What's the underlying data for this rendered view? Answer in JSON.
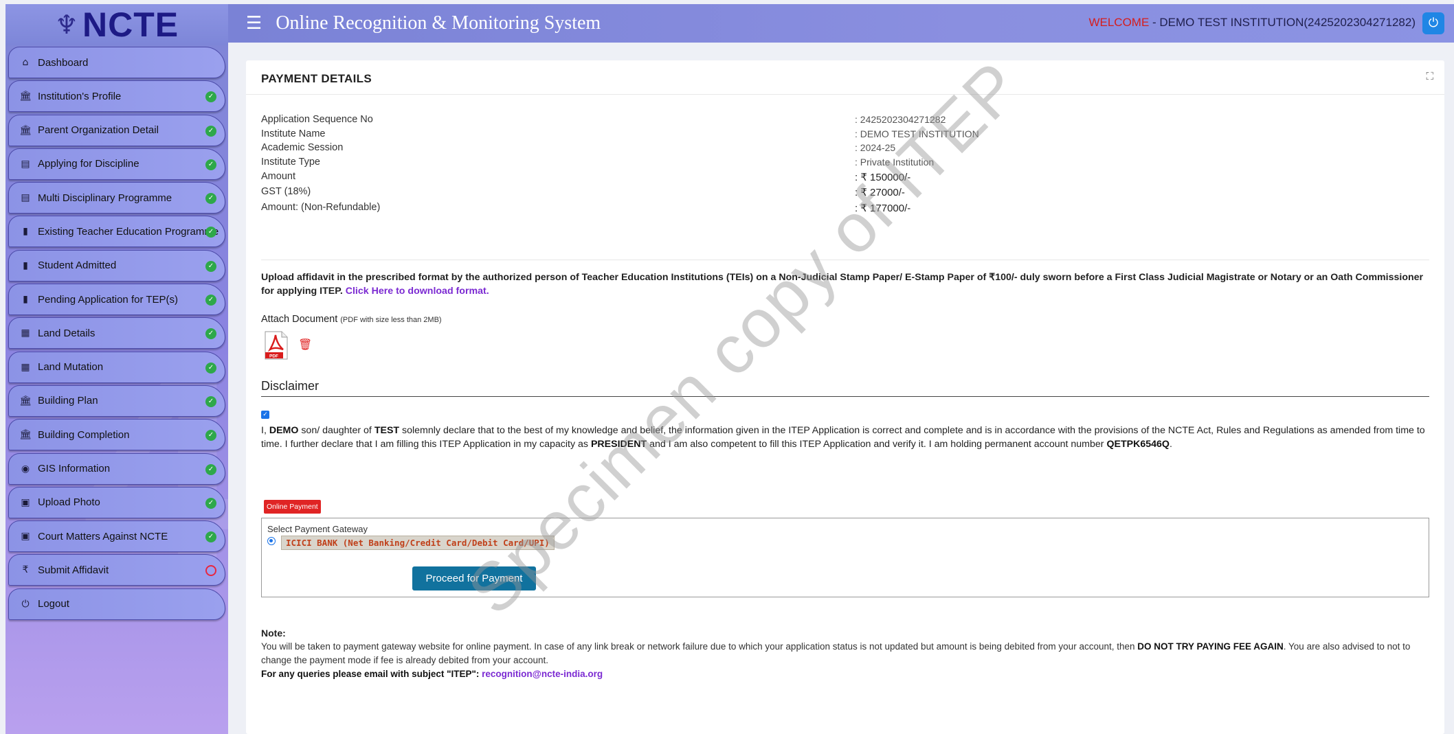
{
  "sidebar": {
    "logo_text": "NCTE",
    "items": [
      {
        "label": "Dashboard",
        "icon": "home-icon",
        "glyph": "⌂",
        "status": "none"
      },
      {
        "label": "Institution's Profile",
        "icon": "institution-icon",
        "glyph": "🏛",
        "status": "done"
      },
      {
        "label": "Parent Organization Detail",
        "icon": "institution-icon",
        "glyph": "🏛",
        "status": "done"
      },
      {
        "label": "Applying for Discipline",
        "icon": "list-icon",
        "glyph": "▤",
        "status": "done"
      },
      {
        "label": "Multi Disciplinary Programme",
        "icon": "list-icon",
        "glyph": "▤",
        "status": "done"
      },
      {
        "label": "Existing Teacher Education Programme",
        "icon": "book-icon",
        "glyph": "▮",
        "status": "done"
      },
      {
        "label": "Student Admitted",
        "icon": "book-icon",
        "glyph": "▮",
        "status": "done"
      },
      {
        "label": "Pending Application for TEP(s)",
        "icon": "book-icon",
        "glyph": "▮",
        "status": "done"
      },
      {
        "label": "Land Details",
        "icon": "grid-icon",
        "glyph": "▦",
        "status": "done"
      },
      {
        "label": "Land Mutation",
        "icon": "table-icon",
        "glyph": "▦",
        "status": "done"
      },
      {
        "label": "Building Plan",
        "icon": "institution-icon",
        "glyph": "🏛",
        "status": "done"
      },
      {
        "label": "Building Completion",
        "icon": "institution-icon",
        "glyph": "🏛",
        "status": "done"
      },
      {
        "label": "GIS Information",
        "icon": "globe-icon",
        "glyph": "◉",
        "status": "done"
      },
      {
        "label": "Upload Photo",
        "icon": "image-icon",
        "glyph": "▣",
        "status": "done"
      },
      {
        "label": "Court Matters Against NCTE",
        "icon": "image-icon",
        "glyph": "▣",
        "status": "done"
      },
      {
        "label": "Submit Affidavit",
        "icon": "rupee-icon",
        "glyph": "₹",
        "status": "pending"
      },
      {
        "label": "Logout",
        "icon": "power-icon",
        "glyph": "⏻",
        "status": "none"
      }
    ]
  },
  "header": {
    "title": "Online Recognition & Monitoring System",
    "welcome_word": "WELCOME",
    "welcome_name": " - DEMO TEST INSTITUTION(2425202304271282)"
  },
  "payment": {
    "title": "PAYMENT DETAILS",
    "rows": [
      {
        "label": "Application Sequence No",
        "value": ":  2425202304271282"
      },
      {
        "label": "Institute Name",
        "value": ":  DEMO TEST INSTITUTION"
      },
      {
        "label": "Academic Session",
        "value": ":  2024-25"
      },
      {
        "label": "Institute Type",
        "value": ":  Private Institution"
      },
      {
        "label": "Amount",
        "value": ":  ₹ 150000/-"
      },
      {
        "label": "GST (18%)",
        "value": ":  ₹ 27000/-"
      },
      {
        "label": "Amount: (Non-Refundable)",
        "value": ":  ₹ 177000/-"
      }
    ],
    "upload_text": "Upload affidavit in the prescribed format by the authorized person of Teacher Education Institutions (TEIs) on a Non-Judicial Stamp Paper/ E-Stamp Paper of ₹100/- duly sworn before a First Class Judicial Magistrate or Notary or an Oath Commissioner for applying ITEP.",
    "upload_link": "Click Here to download format.",
    "attach_label": "Attach Document",
    "attach_hint": "(PDF with size less than 2MB)",
    "pdf_label": "PDF"
  },
  "disclaimer": {
    "title": "Disclaimer",
    "t1": "I, ",
    "name": "DEMO",
    "t2": " son/ daughter of ",
    "parent": "TEST",
    "t3": " solemnly declare that to the best of my knowledge and belief, the information given in the ITEP Application is correct and complete and is in accordance with the provisions of the NCTE Act, Rules and Regulations as amended from time to time. I further declare that I am filling this ITEP Application in my capacity as ",
    "role": "PRESIDENT",
    "t4": " and I am also competent to fill this ITEP Application and verify it. I am holding permanent account number ",
    "pan": "QETPK6546Q",
    "t5": "."
  },
  "gateway": {
    "badge": "Online Payment",
    "label": "Select Payment Gateway",
    "option": "ICICI BANK (Net Banking/Credit Card/Debit Card/UPI)",
    "button": "Proceed for Payment"
  },
  "note": {
    "title": "Note:",
    "t1": "You will be taken to payment gateway website for online payment. In case of any link break or network failure due to which your application status is not updated but amount is being debited from your account, then ",
    "bold1": "DO NOT TRY PAYING FEE AGAIN",
    "t2": ". You are also advised to not to change the payment mode if fee is already debited from your account.",
    "query": "For any queries please email with subject \"ITEP\": ",
    "email": "recognition@ncte-india.org"
  },
  "watermark": "Specimen copy of ITEP"
}
